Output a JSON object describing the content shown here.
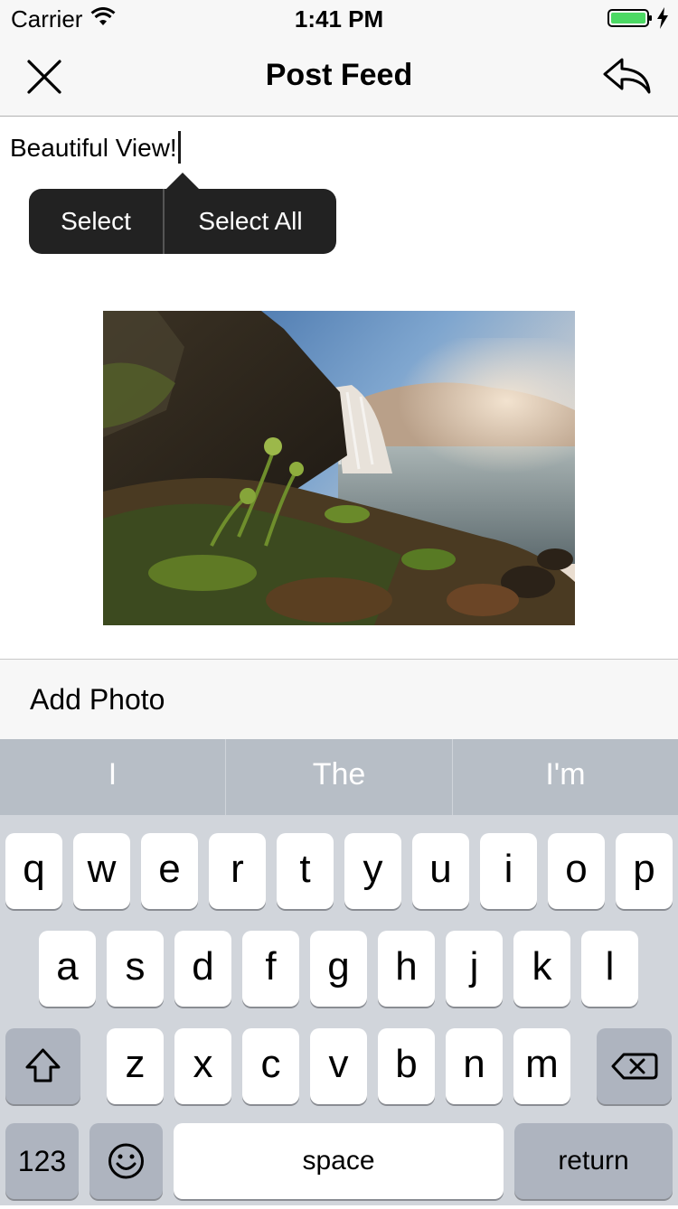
{
  "status_bar": {
    "carrier": "Carrier",
    "time": "1:41 PM",
    "battery_color": "#4cd964"
  },
  "nav": {
    "title": "Post Feed",
    "close_icon": "close-icon",
    "share_icon": "reply-arrow-icon"
  },
  "post": {
    "text": "Beautiful View!"
  },
  "edit_menu": {
    "select": "Select",
    "select_all": "Select All"
  },
  "photo": {
    "subject": "waterfall-landscape"
  },
  "add_photo": {
    "label": "Add Photo"
  },
  "keyboard": {
    "suggestions": [
      "I",
      "The",
      "I'm"
    ],
    "row1": [
      "q",
      "w",
      "e",
      "r",
      "t",
      "y",
      "u",
      "i",
      "o",
      "p"
    ],
    "row2": [
      "a",
      "s",
      "d",
      "f",
      "g",
      "h",
      "j",
      "k",
      "l"
    ],
    "row3": [
      "z",
      "x",
      "c",
      "v",
      "b",
      "n",
      "m"
    ],
    "shift_icon": "shift-icon",
    "delete_icon": "backspace-icon",
    "numbers": "123",
    "emoji_icon": "emoji-icon",
    "space": "space",
    "return": "return"
  }
}
